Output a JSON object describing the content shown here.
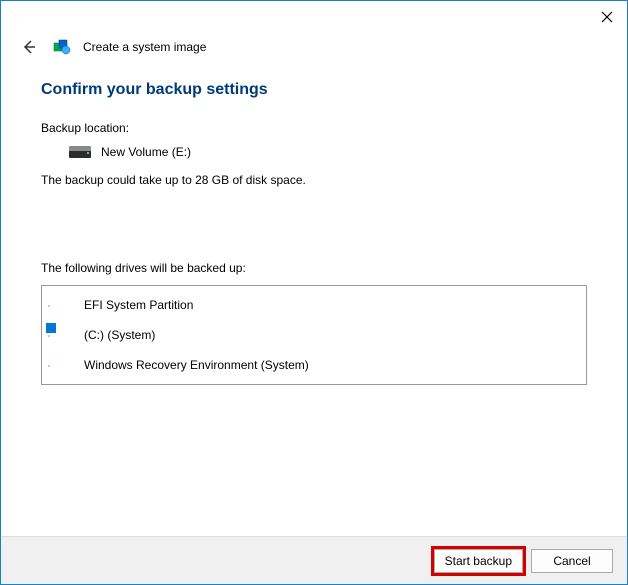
{
  "window": {
    "wizard_title": "Create a system image"
  },
  "content": {
    "heading": "Confirm your backup settings",
    "backup_location_label": "Backup location:",
    "backup_location_value": "New Volume (E:)",
    "size_note": "The backup could take up to 28 GB of disk space.",
    "drives_label": "The following drives will be backed up:",
    "drives": [
      {
        "name": "EFI System Partition",
        "badge": false
      },
      {
        "name": "(C:) (System)",
        "badge": true
      },
      {
        "name": "Windows Recovery Environment (System)",
        "badge": false
      }
    ]
  },
  "buttons": {
    "primary": "Start backup",
    "cancel": "Cancel"
  }
}
